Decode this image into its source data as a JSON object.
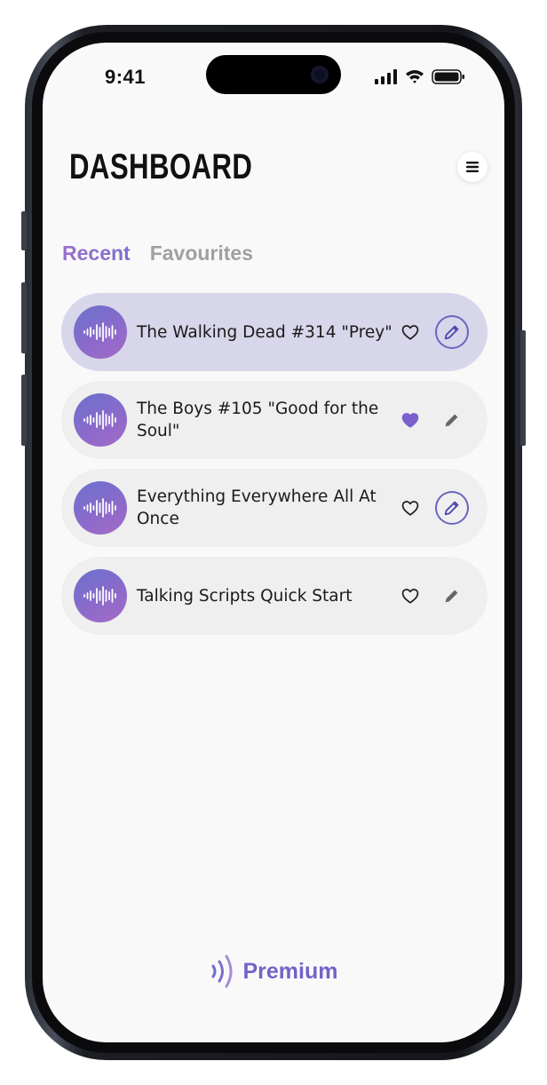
{
  "status_bar": {
    "time": "9:41"
  },
  "header": {
    "title": "DASHBOARD"
  },
  "tabs": [
    {
      "label": "Recent",
      "active": true
    },
    {
      "label": "Favourites",
      "active": false
    }
  ],
  "scripts": [
    {
      "title": "The Walking Dead #314 \"Prey\"",
      "favourite": false,
      "selected": true,
      "edit_style": "outlined"
    },
    {
      "title": "The Boys #105 \"Good for the Soul\"",
      "favourite": true,
      "selected": false,
      "edit_style": "plain"
    },
    {
      "title": "Everything Everywhere All At Once",
      "favourite": false,
      "selected": false,
      "edit_style": "outlined"
    },
    {
      "title": "Talking Scripts Quick Start",
      "favourite": false,
      "selected": false,
      "edit_style": "plain"
    }
  ],
  "footer": {
    "premium_label": "Premium"
  },
  "icons": {
    "menu": "hamburger-icon",
    "avatar": "soundwave-icon",
    "favourite": "heart-icon",
    "edit": "pencil-icon",
    "premium": "sound-waves-icon"
  },
  "colors": {
    "accent": "#7463c6",
    "selected_card": "#d7d6ea",
    "card": "#efefef",
    "heart_filled": "#7b5fcc"
  }
}
